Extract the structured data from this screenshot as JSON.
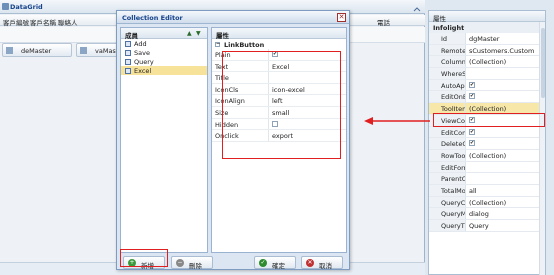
{
  "datagrid": {
    "title": "DataGrid",
    "columns": [
      "客戶編號",
      "客戶名稱",
      "聯絡人",
      "電話"
    ],
    "buttons": [
      "deMaster",
      "vaMaster"
    ]
  },
  "dialog": {
    "title": "Collection Editor",
    "close_glyph": "✕",
    "members_header": "成員",
    "members": [
      "Add",
      "Save",
      "Query",
      "Excel"
    ],
    "selected_member": "Excel",
    "props_header": "屬性",
    "category": "LinkButton",
    "properties": [
      {
        "name": "Plain",
        "value": "",
        "checkbox": true,
        "checked": true
      },
      {
        "name": "Text",
        "value": "Excel"
      },
      {
        "name": "Title",
        "value": ""
      },
      {
        "name": "IconCls",
        "value": "icon-excel"
      },
      {
        "name": "IconAlign",
        "value": "left"
      },
      {
        "name": "Size",
        "value": "small"
      },
      {
        "name": "Hidden",
        "value": "",
        "checkbox": true,
        "checked": false
      },
      {
        "name": "Onclick",
        "value": "export"
      }
    ],
    "add_label": "新增",
    "delete_label": "刪除",
    "ok_label": "確定",
    "cancel_label": "取消"
  },
  "property_grid": {
    "header": "屬性",
    "category": "Infolight",
    "rows": [
      {
        "name": "Id",
        "value": "dgMaster"
      },
      {
        "name": "RemoteName",
        "value": "sCustomers.Custom"
      },
      {
        "name": "Columns",
        "value": "(Collection)"
      },
      {
        "name": "WhereStr",
        "value": ""
      },
      {
        "name": "AutoApply",
        "value": "",
        "checkbox": true,
        "checked": true
      },
      {
        "name": "EditOnEnter",
        "value": "",
        "checkbox": true,
        "checked": true
      },
      {
        "name": "ToolItems",
        "value": "(Collection)",
        "highlight": true
      },
      {
        "name": "ViewCommandVis",
        "value": "",
        "checkbox": true,
        "checked": true
      },
      {
        "name": "EditCommandVisi",
        "value": "",
        "checkbox": true,
        "checked": true
      },
      {
        "name": "DeleteCommandVi",
        "value": "",
        "checkbox": true,
        "checked": true
      },
      {
        "name": "RowToolItems",
        "value": "(Collection)"
      },
      {
        "name": "EditForm",
        "value": ""
      },
      {
        "name": "ParentObject",
        "value": ""
      },
      {
        "name": "TotalMode",
        "value": "all"
      },
      {
        "name": "QueryColumns",
        "value": "(Collection)"
      },
      {
        "name": "QueryMode",
        "value": "dialog"
      },
      {
        "name": "QueryTitle",
        "value": "Query"
      }
    ]
  },
  "colors": {
    "highlight_red": "#e02020",
    "selection": "#f7e29a"
  }
}
